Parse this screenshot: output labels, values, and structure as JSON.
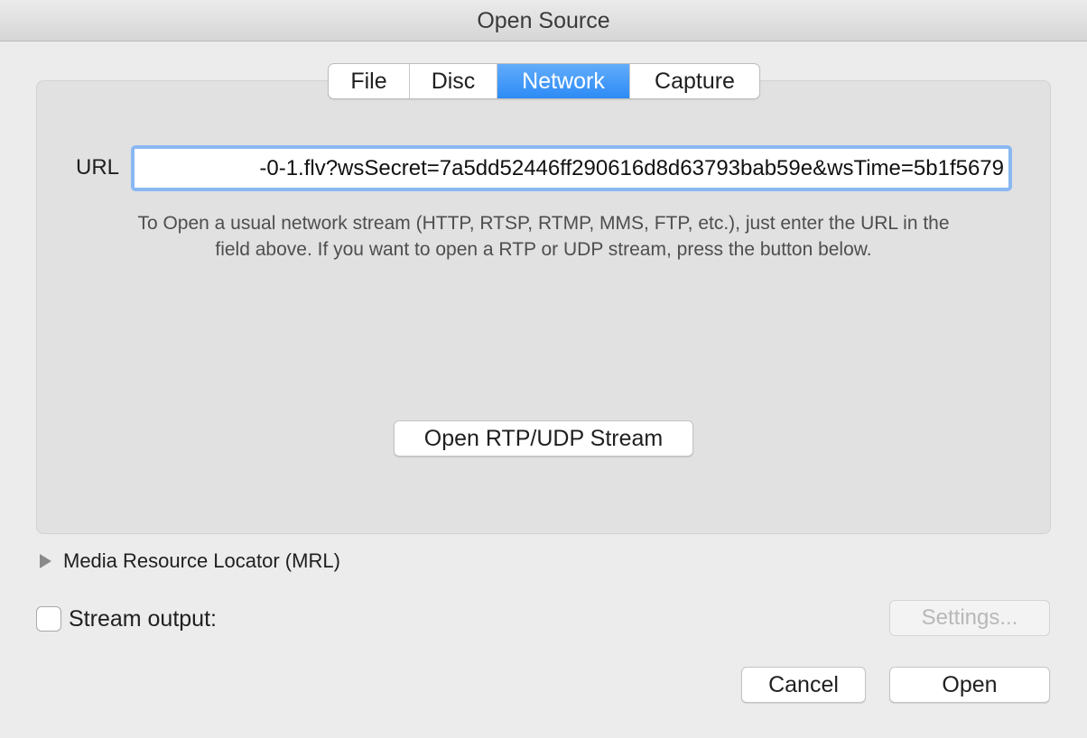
{
  "window": {
    "title": "Open Source"
  },
  "tabs": [
    {
      "label": "File",
      "selected": false
    },
    {
      "label": "Disc",
      "selected": false
    },
    {
      "label": "Network",
      "selected": true
    },
    {
      "label": "Capture",
      "selected": false
    }
  ],
  "network": {
    "url_label": "URL",
    "url_value": "-0-1.flv?wsSecret=7a5dd52446ff290616d8d63793bab59e&wsTime=5b1f5679",
    "hint_line1": "To Open a usual network stream (HTTP, RTSP, RTMP, MMS, FTP, etc.), just enter the URL in the",
    "hint_line2": "field above. If you want to open a RTP or UDP stream, press the button below.",
    "rtp_button_label": "Open RTP/UDP Stream"
  },
  "mrl": {
    "label": "Media Resource Locator (MRL)",
    "expanded": false
  },
  "stream_output": {
    "label": "Stream output:",
    "checked": false,
    "settings_label": "Settings...",
    "settings_enabled": false
  },
  "footer": {
    "cancel_label": "Cancel",
    "open_label": "Open"
  },
  "colors": {
    "accent": "#2d8bf6",
    "focus_ring": "#8ab8f2",
    "window_bg": "#ececec",
    "panel_bg": "#e1e1e1"
  }
}
